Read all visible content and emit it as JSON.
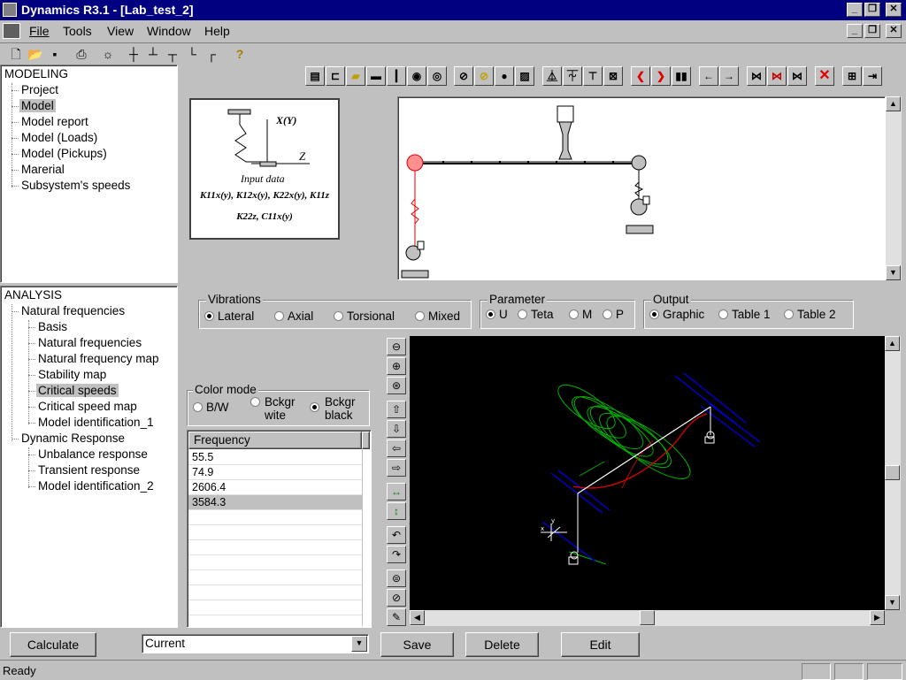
{
  "window": {
    "title": "Dynamics R3.1 - [Lab_test_2]"
  },
  "menu": [
    "File",
    "Tools",
    "View",
    "Window",
    "Help"
  ],
  "modeling_tree": {
    "root": "MODELING",
    "items": [
      "Project",
      "Model",
      "Model report",
      "Model (Loads)",
      "Model (Pickups)",
      "Marerial",
      "Subsystem's speeds"
    ],
    "selected": "Model"
  },
  "analysis_tree": {
    "root": "ANALYSIS",
    "natural": "Natural frequencies",
    "natural_children": [
      "Basis",
      "Natural frequencies",
      "Natural frequency map",
      "Stability map",
      "Critical speeds",
      "Critical speed map",
      "Model identification_1"
    ],
    "dynamic": "Dynamic Response",
    "dynamic_children": [
      "Unbalance response",
      "Transient response",
      "Model identification_2"
    ],
    "selected": "Critical speeds"
  },
  "input_card": {
    "y_axis": "X(Y)",
    "z_axis": "Z",
    "caption": "Input data",
    "line1": "K11x(y), K12x(y), K22x(y), K11z",
    "line2": "K22z, C11x(y)"
  },
  "vibrations": {
    "label": "Vibrations",
    "options": [
      "Lateral",
      "Axial",
      "Torsional",
      "Mixed"
    ],
    "selected": "Lateral"
  },
  "parameter": {
    "label": "Parameter",
    "options": [
      "U",
      "Teta",
      "M",
      "P"
    ],
    "selected": "U"
  },
  "output": {
    "label": "Output",
    "options": [
      "Graphic",
      "Table 1",
      "Table 2"
    ],
    "selected": "Graphic"
  },
  "color_mode": {
    "label": "Color mode",
    "options": [
      "B/W",
      "Bckgr wite",
      "Bckgr black"
    ],
    "selected": "Bckgr black"
  },
  "frequency_table": {
    "header": "Frequency",
    "rows": [
      "55.5",
      "74.9",
      "2606.4",
      "3584.3"
    ],
    "selected": "3584.3"
  },
  "bottom": {
    "calculate": "Calculate",
    "combo_value": "Current",
    "save": "Save",
    "delete": "Delete",
    "edit": "Edit"
  },
  "status": {
    "text": "Ready"
  },
  "colors": {
    "titlebar": "#000080",
    "face": "#c0c0c0",
    "plot_bg": "#000000",
    "red_tool": "#e00000"
  }
}
